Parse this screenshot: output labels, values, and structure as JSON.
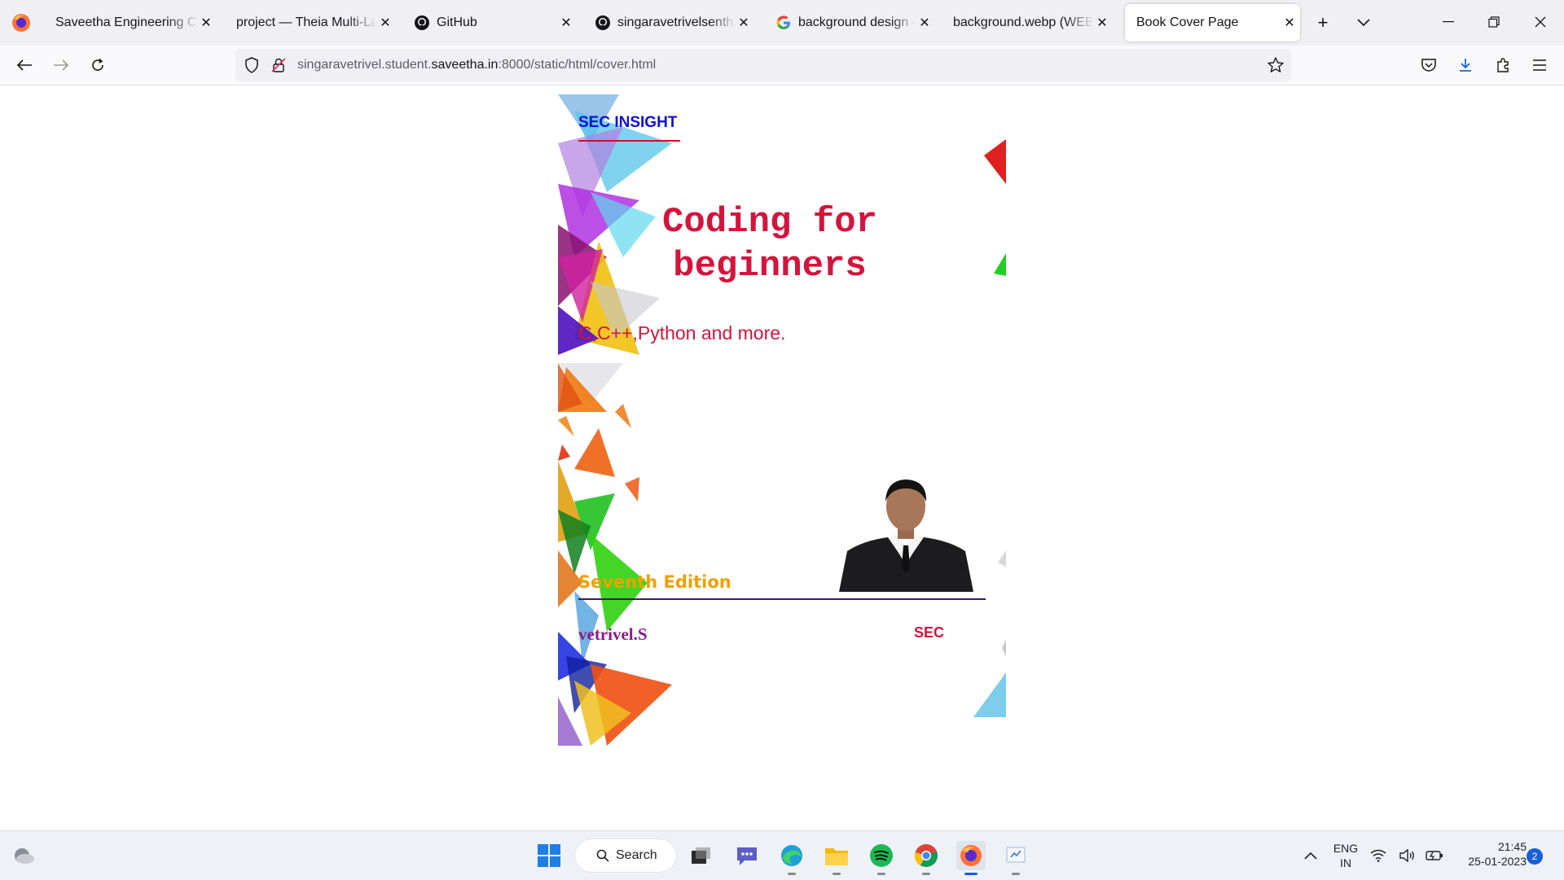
{
  "browser": {
    "tabs": [
      {
        "title": "Saveetha Engineering Colle",
        "favicon": "firefox-logo-icon"
      },
      {
        "title": "project — Theia Multi-Lang",
        "favicon": "none"
      },
      {
        "title": "GitHub",
        "favicon": "github-icon"
      },
      {
        "title": "singaravetrivelsenthilk",
        "favicon": "github-icon"
      },
      {
        "title": "background design - G",
        "favicon": "google-icon"
      },
      {
        "title": "background.webp (WEBP I",
        "favicon": "none"
      },
      {
        "title": "Book Cover Page",
        "favicon": "none",
        "active": true
      }
    ],
    "url": {
      "prefix": "singaravetrivel.student.",
      "domain": "saveetha.in",
      "suffix": ":8000/static/html/cover.html"
    }
  },
  "cover": {
    "publisher": "SEC INSIGHT",
    "title_line1": "Coding for",
    "title_line2": "beginners",
    "subtitle": "C,C++,Python and more.",
    "edition": "Seventh Edition",
    "author": "vetrivel.S",
    "org": "SEC",
    "colors": {
      "title": "#d4143c",
      "publisher": "#1010d8",
      "edition": "#f0a000",
      "author": "#8b1a8b"
    }
  },
  "taskbar": {
    "search_label": "Search",
    "lang_line1": "ENG",
    "lang_line2": "IN",
    "time": "21:45",
    "date": "25-01-2023",
    "notification_count": "2"
  }
}
